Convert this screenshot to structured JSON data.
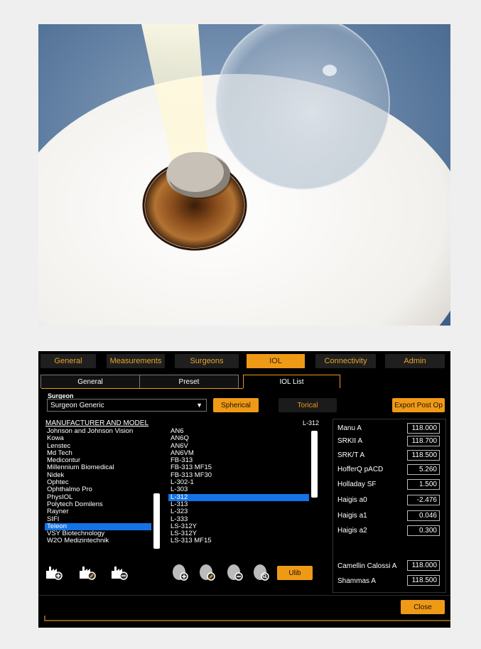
{
  "top_tabs": [
    {
      "label": "General",
      "active": false
    },
    {
      "label": "Measurements",
      "active": false
    },
    {
      "label": "Surgeons",
      "active": false
    },
    {
      "label": "IOL",
      "active": true
    },
    {
      "label": "Connectivity",
      "active": false
    },
    {
      "label": "Admin",
      "active": false
    }
  ],
  "sub_tabs": [
    {
      "label": "General",
      "active": false
    },
    {
      "label": "Preset",
      "active": false
    },
    {
      "label": "IOL List",
      "active": true
    }
  ],
  "surgeon": {
    "label": "Surgeon",
    "selected": "Surgeon Generic"
  },
  "buttons": {
    "spherical": "Spherical",
    "toric": "Torical",
    "export": "Export Post Op",
    "ulib": "Ulib",
    "close": "Close"
  },
  "manufacturer_header": "MANUFACTURER AND MODEL",
  "selected_model_label": "L-312",
  "manufacturers": [
    "Johnson and Johnson Vision",
    "Kowa",
    "Lenstec",
    "Md Tech",
    "Medicontur",
    "Millennium Biomedical",
    "Nidek",
    "Ophtec",
    "Ophthalmo Pro",
    "PhysIOL",
    "Polytech Domilens",
    "Rayner",
    "SIFI",
    "Teleon",
    "VSY Biotechnology",
    "W2O Medizintechnik"
  ],
  "selected_manufacturer": "Teleon",
  "models": [
    "AN6",
    "AN6Q",
    "AN6V",
    "AN6VM",
    "FB-313",
    "FB-313 MF15",
    "FB-313 MF30",
    "L-302-1",
    "L-303",
    "L-312",
    "L-313",
    "L-323",
    "L-333",
    "LS-312Y",
    "LS-312Y",
    "LS-313 MF15"
  ],
  "selected_model": "L-312",
  "params": [
    {
      "label": "Manu A",
      "value": "118.000"
    },
    {
      "label": "SRKII A",
      "value": "118.700"
    },
    {
      "label": "SRK/T A",
      "value": "118.500"
    },
    {
      "label": "HofferQ pACD",
      "value": "5.260"
    },
    {
      "label": "Holladay SF",
      "value": "1.500"
    },
    {
      "label": "Haigis a0",
      "value": "-2.476"
    },
    {
      "label": "Haigis a1",
      "value": "0.046"
    },
    {
      "label": "Haigis a2",
      "value": "0.300"
    }
  ],
  "params_bottom": [
    {
      "label": "Camellin Calossi A",
      "value": "118.000"
    },
    {
      "label": "Shammas A",
      "value": "118.500"
    }
  ],
  "icons": [
    "add-manufacturer-icon",
    "edit-manufacturer-icon",
    "remove-manufacturer-icon",
    "add-lens-icon",
    "edit-lens-icon",
    "remove-lens-icon",
    "search-lens-icon"
  ]
}
